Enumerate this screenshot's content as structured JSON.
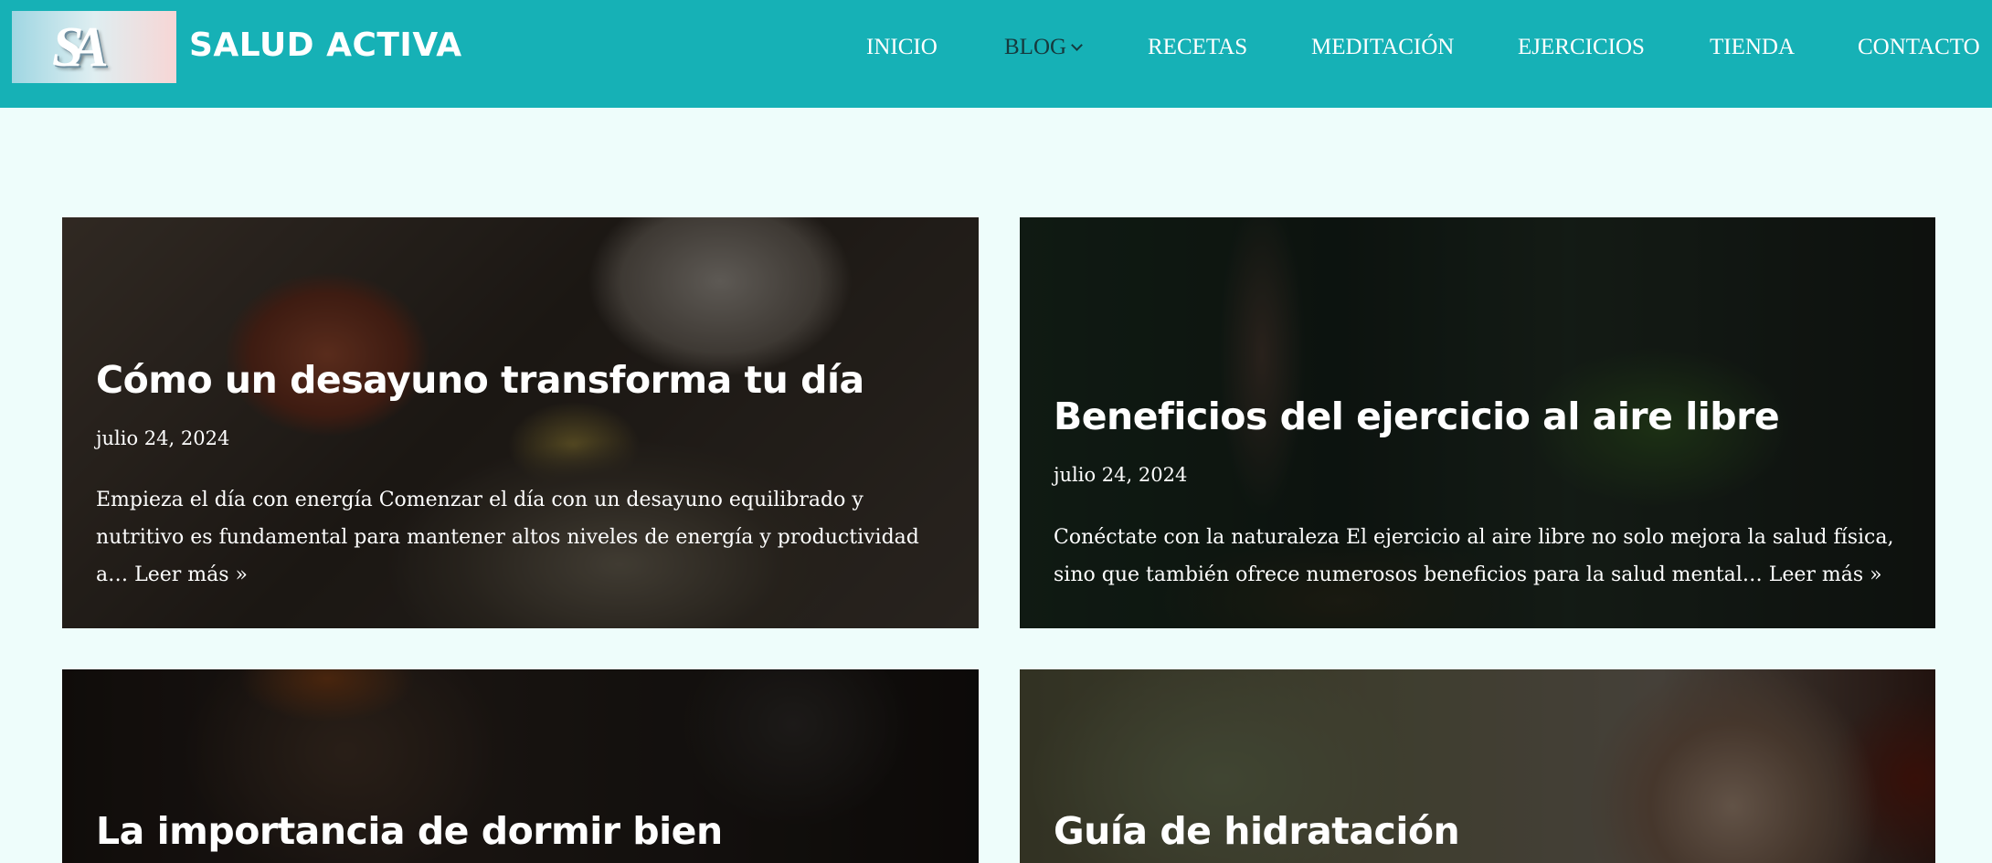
{
  "site": {
    "logo_letters": "SA",
    "title": "SALUD ACTIVA"
  },
  "nav": {
    "items": [
      {
        "label": "INICIO"
      },
      {
        "label": "BLOG",
        "active": true
      },
      {
        "label": "RECETAS"
      },
      {
        "label": "MEDITACIÓN"
      },
      {
        "label": "EJERCICIOS"
      },
      {
        "label": "TIENDA"
      },
      {
        "label": "CONTACTO"
      }
    ]
  },
  "posts": [
    {
      "title": "Cómo un desayuno transforma tu día",
      "date": "julio 24, 2024",
      "excerpt": "Empieza el día con energía Comenzar el día con un desayuno equilibrado y nutritivo es fundamental para mantener altos niveles de energía y productividad a…",
      "read_more": "Leer más »"
    },
    {
      "title": "Beneficios del ejercicio al aire libre",
      "date": "julio 24, 2024",
      "excerpt": "Conéctate con la naturaleza El ejercicio al aire libre no solo mejora la salud física, sino que también ofrece numerosos beneficios para la salud mental…",
      "read_more": "Leer más »"
    },
    {
      "title": "La importancia de dormir bien"
    },
    {
      "title": "Guía de hidratación"
    }
  ],
  "colors": {
    "header_bg": "#16b1b6",
    "page_bg": "#eefdfb",
    "active_nav": "#16393d"
  }
}
